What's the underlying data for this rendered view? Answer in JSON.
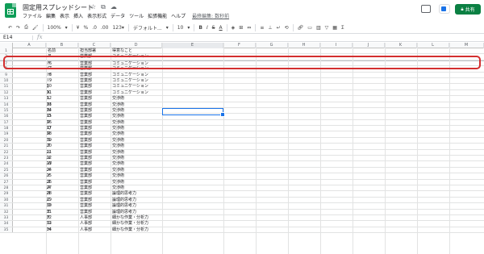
{
  "doc": {
    "title": "固定用スプレッドシート",
    "last_edit": "最終編集: 数秒前",
    "share_label": "共有"
  },
  "menu": [
    "ファイル",
    "編集",
    "表示",
    "挿入",
    "表示形式",
    "データ",
    "ツール",
    "拡張機能",
    "ヘルプ"
  ],
  "toolbar": {
    "zoom": "100%",
    "currency": "¥",
    "percent": "%",
    "decimal_down": ".0",
    "decimal_up": ".00",
    "number_format": "123▾",
    "font": "デフォルト...",
    "font_size": "10",
    "bold": "B",
    "italic": "I",
    "strike": "S",
    "text_color": "A"
  },
  "formula_bar": {
    "cell_ref": "E14",
    "fx": "fx"
  },
  "columns": [
    "A",
    "B",
    "C",
    "D",
    "E",
    "F",
    "G",
    "H",
    "I",
    "J",
    "K",
    "L",
    "M"
  ],
  "rows": [
    {
      "n": "1",
      "a": "",
      "b": "名前",
      "c": "担当部署",
      "d": "得意なこと"
    },
    {
      "n": "2",
      "a": "1",
      "b": "A",
      "c": "営業部",
      "d": "コミュニケーション"
    },
    {
      "n": "7",
      "a": "6",
      "b": "F",
      "c": "営業部",
      "d": "コミュニケーション"
    },
    {
      "n": "8",
      "a": "7",
      "b": "G",
      "c": "営業部",
      "d": "コミュニケーション"
    },
    {
      "n": "9",
      "a": "8",
      "b": "H",
      "c": "営業部",
      "d": "コミュニケーション"
    },
    {
      "n": "10",
      "a": "9",
      "b": "I",
      "c": "営業部",
      "d": "コミュニケーション"
    },
    {
      "n": "11",
      "a": "10",
      "b": "J",
      "c": "営業部",
      "d": "コミュニケーション"
    },
    {
      "n": "12",
      "a": "11",
      "b": "K",
      "c": "営業部",
      "d": "コミュニケーション"
    },
    {
      "n": "13",
      "a": "12",
      "b": "L",
      "c": "営業部",
      "d": "交渉術"
    },
    {
      "n": "14",
      "a": "13",
      "b": "M",
      "c": "営業部",
      "d": "交渉術"
    },
    {
      "n": "15",
      "a": "14",
      "b": "N",
      "c": "営業部",
      "d": "交渉術"
    },
    {
      "n": "16",
      "a": "15",
      "b": "O",
      "c": "営業部",
      "d": "交渉術"
    },
    {
      "n": "17",
      "a": "16",
      "b": "P",
      "c": "営業部",
      "d": "交渉術"
    },
    {
      "n": "18",
      "a": "17",
      "b": "Q",
      "c": "営業部",
      "d": "交渉術"
    },
    {
      "n": "19",
      "a": "18",
      "b": "R",
      "c": "営業部",
      "d": "交渉術"
    },
    {
      "n": "20",
      "a": "19",
      "b": "S",
      "c": "営業部",
      "d": "交渉術"
    },
    {
      "n": "21",
      "a": "20",
      "b": "T",
      "c": "営業部",
      "d": "交渉術"
    },
    {
      "n": "22",
      "a": "21",
      "b": "U",
      "c": "営業部",
      "d": "交渉術"
    },
    {
      "n": "23",
      "a": "22",
      "b": "V",
      "c": "営業部",
      "d": "交渉術"
    },
    {
      "n": "24",
      "a": "23",
      "b": "W",
      "c": "営業部",
      "d": "交渉術"
    },
    {
      "n": "25",
      "a": "24",
      "b": "X",
      "c": "営業部",
      "d": "交渉術"
    },
    {
      "n": "26",
      "a": "25",
      "b": "Y",
      "c": "営業部",
      "d": "交渉術"
    },
    {
      "n": "27",
      "a": "26",
      "b": "Z",
      "c": "営業部",
      "d": "交渉術"
    },
    {
      "n": "28",
      "a": "27",
      "b": "A",
      "c": "営業部",
      "d": "交渉術"
    },
    {
      "n": "29",
      "a": "28",
      "b": "B",
      "c": "営業部",
      "d": "論理的思考力"
    },
    {
      "n": "30",
      "a": "29",
      "b": "C",
      "c": "営業部",
      "d": "論理的思考力"
    },
    {
      "n": "31",
      "a": "30",
      "b": "D",
      "c": "営業部",
      "d": "論理的思考力"
    },
    {
      "n": "32",
      "a": "31",
      "b": "E",
      "c": "営業部",
      "d": "論理的思考力"
    },
    {
      "n": "33",
      "a": "32",
      "b": "F",
      "c": "人事部",
      "d": "細かな作業・分析力"
    },
    {
      "n": "34",
      "a": "33",
      "b": "G",
      "c": "人事部",
      "d": "細かな作業・分析力"
    },
    {
      "n": "35",
      "a": "34",
      "b": "H",
      "c": "人事部",
      "d": "細かな作業・分析力"
    }
  ]
}
